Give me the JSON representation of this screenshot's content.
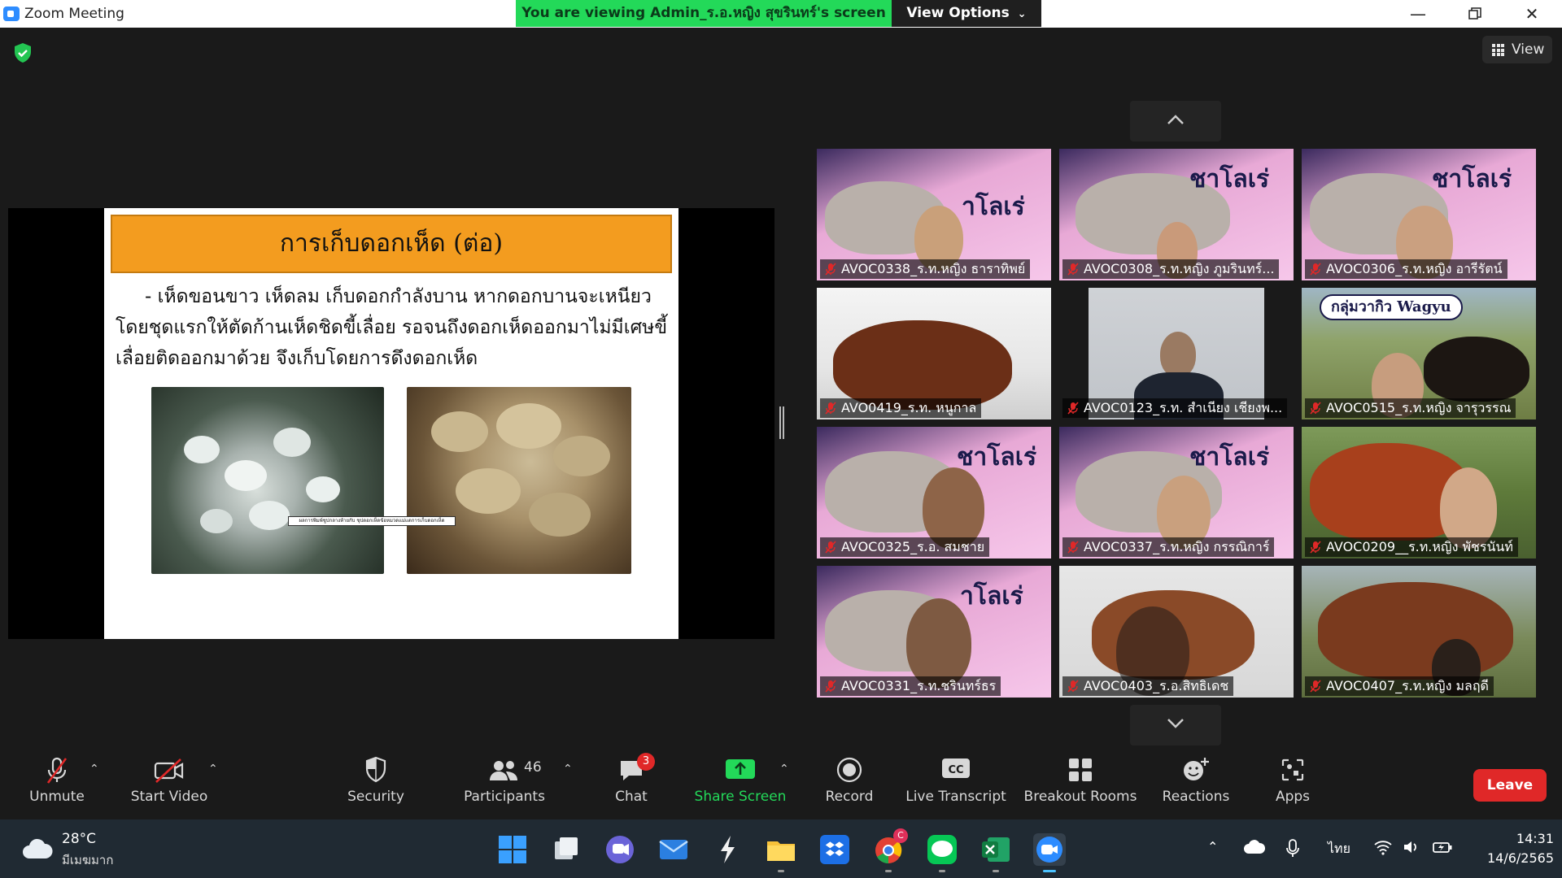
{
  "window": {
    "title": "Zoom Meeting",
    "viewing_banner": "You are viewing Admin_ร.อ.หญิง สุขรินทร์'s screen",
    "view_options": "View Options",
    "view_button": "View"
  },
  "slide": {
    "title": "การเก็บดอกเห็ด (ต่อ)",
    "line1": "- เห็ดขอนขาว เห็ดลม  เก็บดอกกำลังบาน หากดอกบานจะเหนียว",
    "line2": "โดยชุดแรกให้ตัดก้านเห็ดชิดขี้เลื่อย รอจนถึงดอกเห็ดออกมาไม่มีเศษขี้",
    "line3": "เลื่อยติดออกมาด้วย จึงเก็บโดยการดึงดอกเห็ด",
    "caption": "ผลการพิมพ์ชูปกลางท้ายกับ ชุปดอกเห็ดข้อหมวดแม่แดการเก็บดอกเห็ด"
  },
  "sign_texts": {
    "charolais": "ชาโลเร่",
    "charolais_partial": "าโลเร่",
    "wagyu": "กลุ่มวากิว Wagyu"
  },
  "participants": [
    {
      "name": "AVOC0338_ร.ท.หญิง ธาราทิพย์"
    },
    {
      "name": "AVOC0308_ร.ท.หญิง ภูมรินทร์..."
    },
    {
      "name": "AVOC0306_ร.ท.หญิง อารีรัตน์"
    },
    {
      "name": "AVO0419_ร.ท. หนูกาล"
    },
    {
      "name": "AVOC0123_ร.ท. สำเนียง เชียงพ..."
    },
    {
      "name": "AVOC0515_ร.ท.หญิง จารุวรรณ"
    },
    {
      "name": "AVOC0325_ร.อ. สมชาย"
    },
    {
      "name": "AVOC0337_ร.ท.หญิง กรรณิการ์"
    },
    {
      "name": "AVOC0209__ร.ท.หญิง พัชรนันท์"
    },
    {
      "name": "AVOC0331_ร.ท.ชรินทร์ธร"
    },
    {
      "name": "AVOC0403_ร.อ.สิทธิเดช"
    },
    {
      "name": "AVOC0407_ร.ท.หญิง มลฤดี"
    }
  ],
  "toolbar": {
    "unmute": "Unmute",
    "start_video": "Start Video",
    "security": "Security",
    "participants": "Participants",
    "participants_count": "46",
    "chat": "Chat",
    "chat_badge": "3",
    "share_screen": "Share Screen",
    "record": "Record",
    "live_transcript": "Live Transcript",
    "breakout_rooms": "Breakout Rooms",
    "reactions": "Reactions",
    "apps": "Apps",
    "leave": "Leave",
    "share_color": "#23d959",
    "leave_color": "#e02828"
  },
  "taskbar": {
    "temperature": "28°C",
    "weather_desc": "มีเมฆมาก",
    "language": "ไทย",
    "time": "14:31",
    "date": "14/6/2565",
    "chrome_badge": "C"
  }
}
